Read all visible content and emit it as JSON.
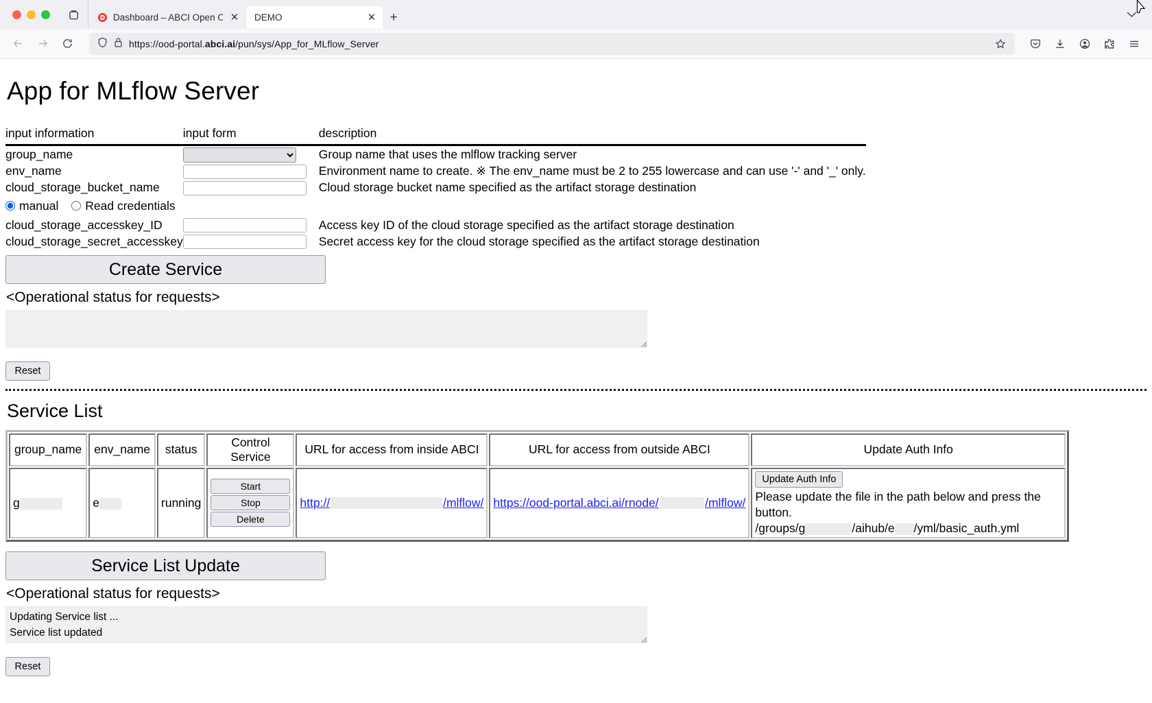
{
  "browser": {
    "tabs": [
      {
        "title": "Dashboard – ABCI Open OnDemand",
        "active": false,
        "favicon": "abci-logo-icon"
      },
      {
        "title": "DEMO",
        "active": true,
        "favicon": "none"
      }
    ],
    "new_tab_label": "+",
    "url": "https://ood-portal.abci.ai/pun/sys/App_for_MLflow_Server",
    "url_bold": "abci.ai",
    "url_prefix": "https://ood-portal.",
    "url_suffix": "/pun/sys/App_for_MLflow_Server",
    "toolbar_icons": [
      "pocket-icon",
      "download-icon",
      "account-icon",
      "extension-icon",
      "menu-icon"
    ],
    "nav_icons": [
      "back-arrow-icon",
      "forward-arrow-icon",
      "reload-icon"
    ],
    "urlbar_icons": [
      "shield-icon",
      "lock-icon",
      "star-icon"
    ]
  },
  "page": {
    "title": "App for MLflow Server",
    "form": {
      "headers": [
        "input information",
        "input form",
        "description"
      ],
      "rows": [
        {
          "label": "group_name",
          "control": "select",
          "value": "",
          "description": "Group name that uses the mlflow tracking server"
        },
        {
          "label": "env_name",
          "control": "text",
          "value": "",
          "description": "Environment name to create. ※ The env_name must be 2 to 255 lowercase and can use '-' and '_' only."
        },
        {
          "label": "cloud_storage_bucket_name",
          "control": "text",
          "value": "",
          "description": "Cloud storage bucket name specified as the artifact storage destination"
        },
        {
          "label": "cloud_storage_accesskey_ID",
          "control": "text",
          "value": "",
          "description": "Access key ID of the cloud storage specified as the artifact storage destination"
        },
        {
          "label": "cloud_storage_secret_accesskey",
          "control": "text",
          "value": "",
          "description": "Secret access key for the cloud storage specified as the artifact storage destination"
        }
      ],
      "credential_mode": {
        "options": [
          {
            "label": "manual",
            "selected": true
          },
          {
            "label": "Read credentials",
            "selected": false
          }
        ]
      }
    },
    "create_button": "Create Service",
    "create_status_label": "<Operational status for requests>",
    "create_status_text": "",
    "create_reset_button": "Reset",
    "service_list": {
      "heading": "Service List",
      "headers": [
        "group_name",
        "env_name",
        "status",
        "Control Service",
        "URL for access from inside ABCI",
        "URL for access from outside ABCI",
        "Update Auth Info"
      ],
      "rows": [
        {
          "group_name": "g",
          "group_name_redacted": true,
          "env_name": "e",
          "env_name_redacted": true,
          "status": "running",
          "controls": [
            "Start",
            "Stop",
            "Delete"
          ],
          "inside_url_prefix": "http://",
          "inside_url_suffix": "/mlflow/",
          "outside_url_prefix": "https://ood-portal.abci.ai/rnode/",
          "outside_url_suffix": "/mlflow/",
          "auth_button": "Update Auth Info",
          "auth_text": "Please update the file in the path below and press the button.",
          "auth_path_prefix": "/groups/g",
          "auth_path_mid": "/aihub/e",
          "auth_path_suffix": "/yml/basic_auth.yml"
        }
      ]
    },
    "update_button": "Service List Update",
    "update_status_label": "<Operational status for requests>",
    "update_status_text": "Updating Service list ...\nService list updated",
    "update_reset_button": "Reset"
  }
}
